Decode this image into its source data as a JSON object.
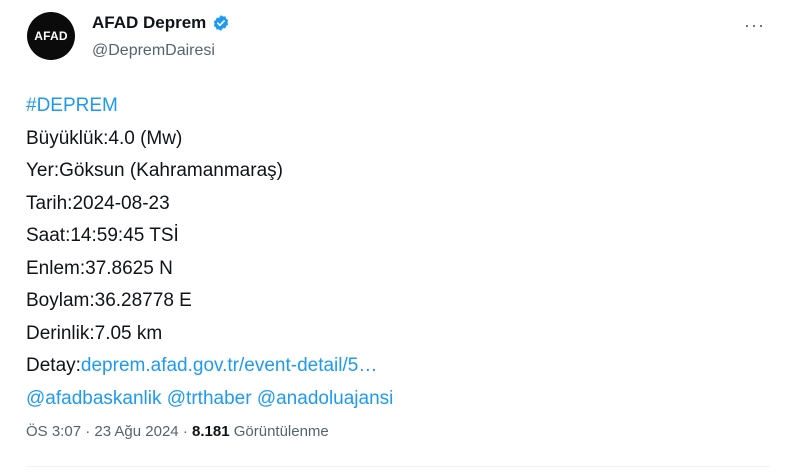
{
  "author": {
    "display_name": "AFAD Deprem",
    "handle": "@DepremDairesi",
    "avatar_text": "AFAD",
    "verified": true
  },
  "more_label": "···",
  "tweet": {
    "hashtag": "#DEPREM",
    "lines": [
      "Büyüklük:4.0 (Mw)",
      "Yer:Göksun (Kahramanmaraş)",
      "Tarih:2024-08-23",
      "Saat:14:59:45 TSİ",
      "Enlem:37.8625 N",
      "Boylam:36.28778 E",
      "Derinlik:7.05 km"
    ],
    "detail_label": "Detay:",
    "detail_link": "deprem.afad.gov.tr/event-detail/5…",
    "mentions": [
      "@afadbaskanlik",
      "@trthaber",
      "@anadoluajansi"
    ]
  },
  "meta": {
    "time": "ÖS 3:07",
    "date": "23 Ağu 2024",
    "separator1": "·",
    "separator2": "·",
    "views_count": "8.181",
    "views_label": "Görüntülenme"
  },
  "colors": {
    "link": "#1d9bf0",
    "text": "#0f1419",
    "secondary": "#536471",
    "verified_badge": "#1d9bf0"
  }
}
